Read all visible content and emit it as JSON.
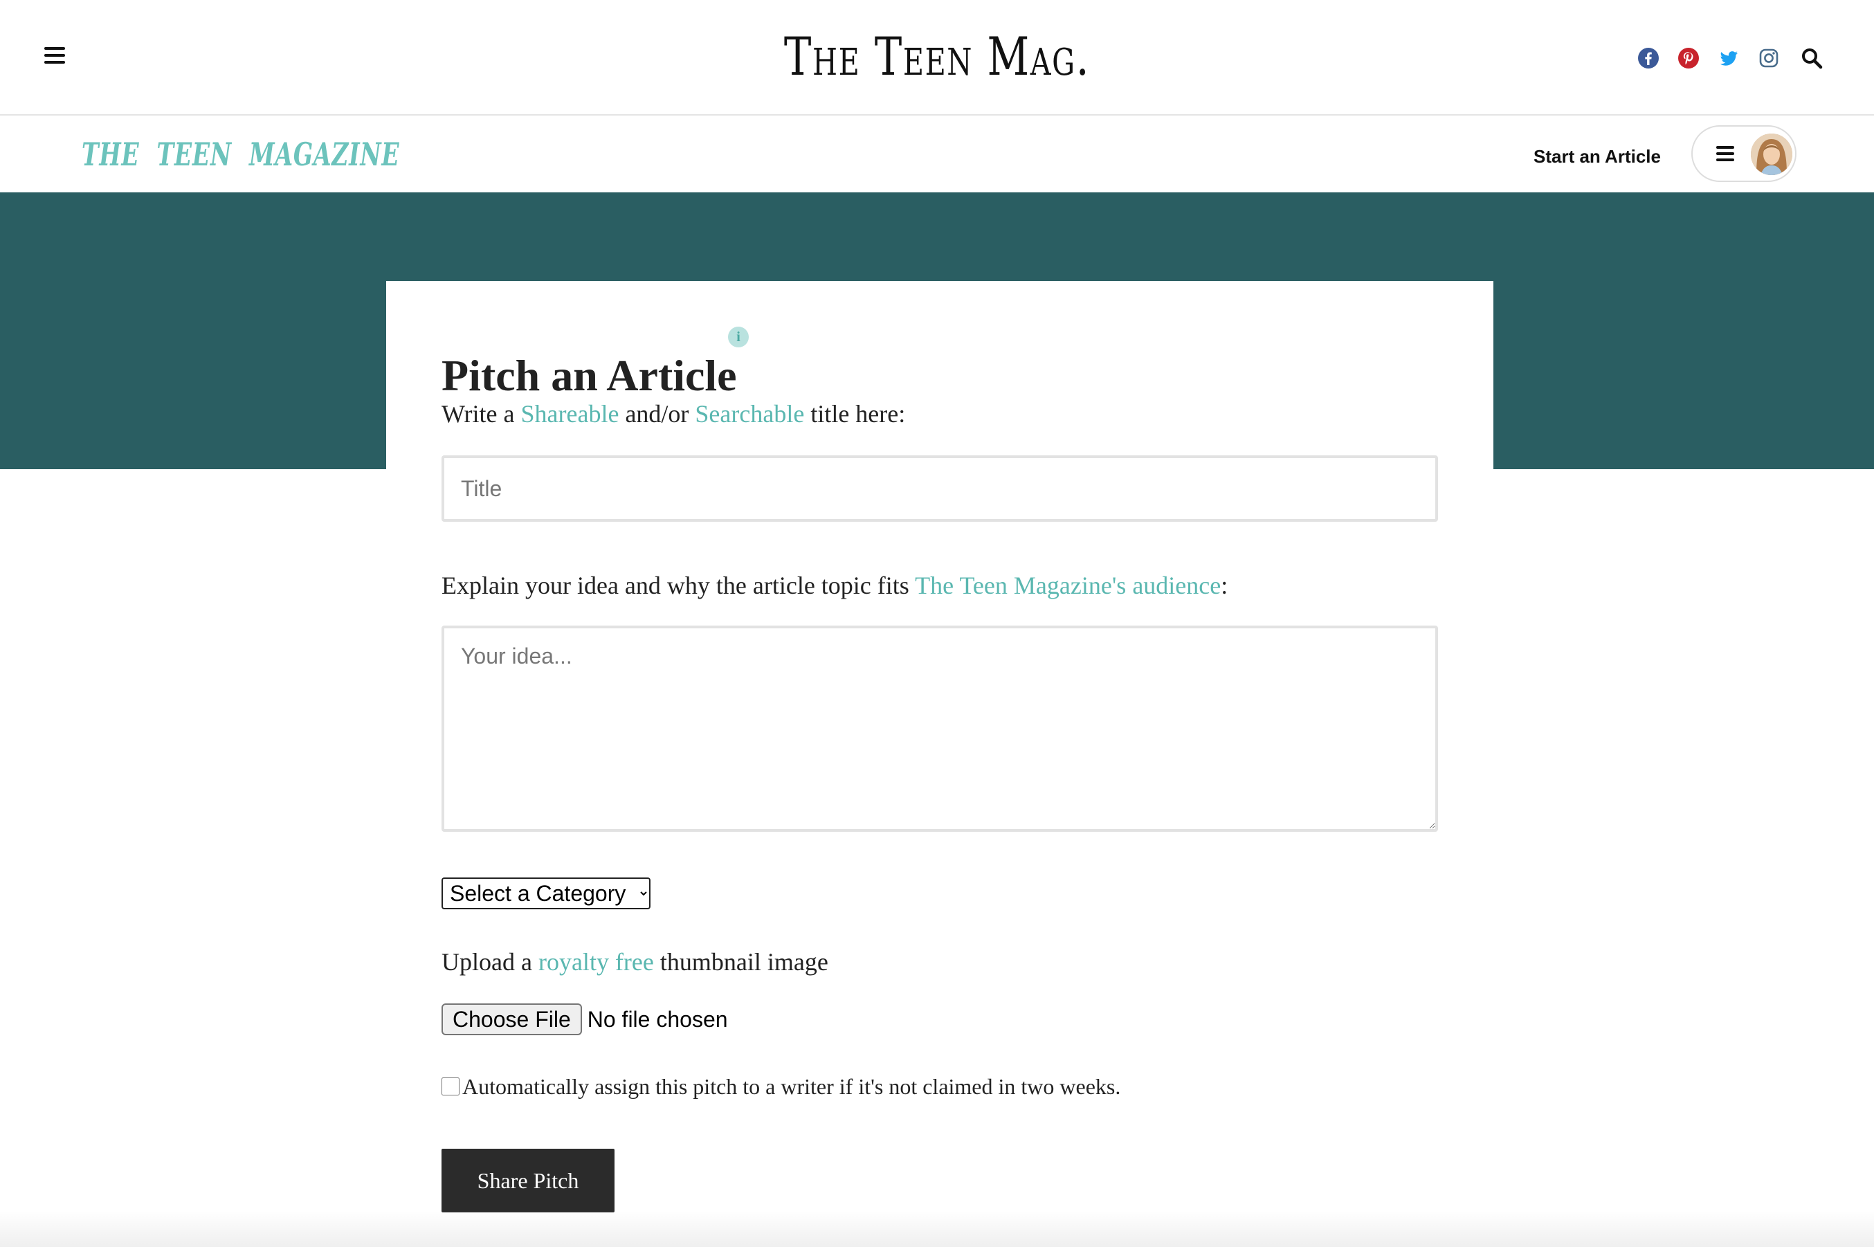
{
  "header": {
    "brand": "The Teen Mag.",
    "social": [
      "facebook-icon",
      "pinterest-icon",
      "twitter-icon",
      "instagram-icon"
    ],
    "colors": {
      "facebook": "#3b5998",
      "pinterest": "#c8232c",
      "twitter": "#1da1f2",
      "instagram": "#4a6d8c"
    }
  },
  "subnav": {
    "magazine_logo": "THE TEEN MAGAZINE",
    "start_article": "Start an Article"
  },
  "form": {
    "title": "Pitch an Article",
    "info": "i",
    "title_label": {
      "prefix": "Write a ",
      "link1": "Shareable",
      "middle": " and/or ",
      "link2": "Searchable",
      "suffix": " title here:"
    },
    "title_placeholder": "Title",
    "idea_label": {
      "prefix": "Explain your idea and why the article topic fits ",
      "link": "The Teen Magazine's audience",
      "suffix": ":"
    },
    "idea_placeholder": "Your idea...",
    "category_selected": "Select a Category",
    "upload_label": {
      "prefix": "Upload a ",
      "link": "royalty free",
      "suffix": " thumbnail image"
    },
    "choose_file": "Choose File",
    "file_status": "No file chosen",
    "auto_assign": "Automatically assign this pitch to a writer if it's not claimed in two weeks.",
    "submit": "Share Pitch"
  },
  "colors": {
    "accent": "#5ab7b0",
    "band": "#2a5e62",
    "button": "#2b2b2b"
  }
}
